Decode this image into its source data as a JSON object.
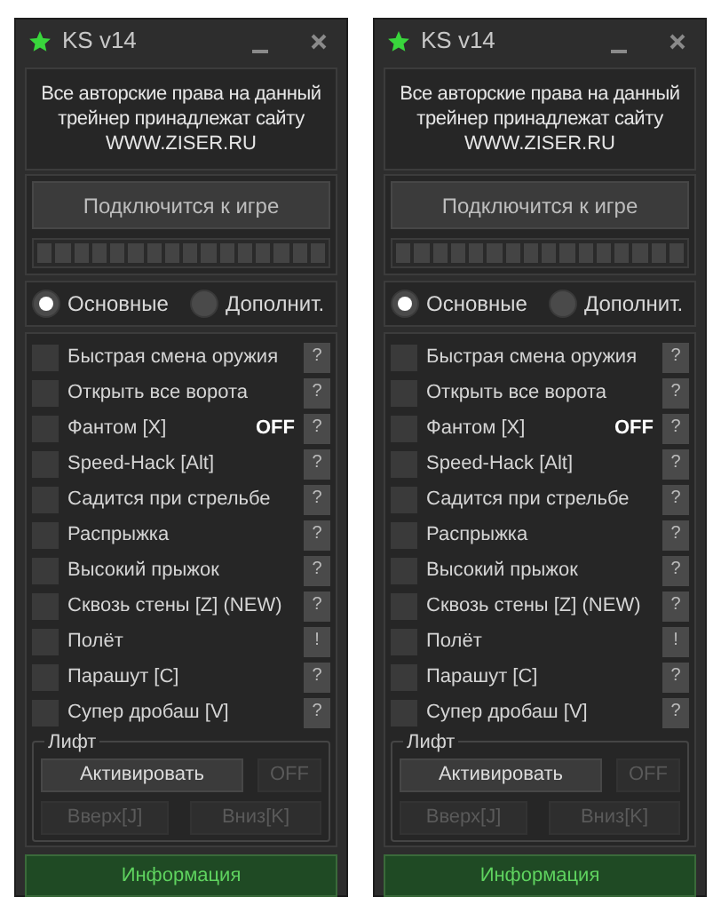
{
  "windows": [
    {
      "title": "KS v14",
      "notice": "Все авторские права на данный трейнер принадлежат сайту",
      "site": "WWW.ZISER.RU",
      "connect_button": "Подключится к игре",
      "progress": {
        "level": 0
      },
      "tabs": [
        {
          "label": "Основные",
          "selected": true
        },
        {
          "label": "Дополнит.",
          "selected": false
        }
      ],
      "options": [
        {
          "label": "Быстрая смена оружия",
          "checked": false,
          "help": "?"
        },
        {
          "label": "Открыть все ворота",
          "checked": false,
          "help": "?"
        },
        {
          "label": "Фантом [X]",
          "checked": false,
          "status": "OFF",
          "help": "?"
        },
        {
          "label": "Speed-Hack [Alt]",
          "checked": false,
          "help": "?"
        },
        {
          "label": "Садится при стрельбе",
          "checked": false,
          "help": "?"
        },
        {
          "label": "Распрыжка",
          "checked": false,
          "help": "?"
        },
        {
          "label": "Высокий прыжок",
          "checked": false,
          "help": "?"
        },
        {
          "label": "Сквозь стены [Z] (NEW)",
          "checked": false,
          "help": "?"
        },
        {
          "label": "Полёт",
          "checked": false,
          "help": "!"
        },
        {
          "label": "Парашут [C]",
          "checked": false,
          "help": "?"
        },
        {
          "label": "Супер дробаш [V]",
          "checked": false,
          "help": "?"
        }
      ],
      "lift": {
        "legend": "Лифт",
        "buttons": [
          {
            "label": "Активировать",
            "disabled": false
          },
          {
            "label": "OFF",
            "disabled": true
          },
          {
            "label": "Вверх[J]",
            "disabled": true
          },
          {
            "label": "Вниз[K]",
            "disabled": true
          }
        ]
      },
      "info_button": "Информация"
    },
    {
      "title": "KS v14",
      "notice": "Все авторские права на данный трейнер принадлежат сайту",
      "site": "WWW.ZISER.RU",
      "connect_button": "Подключится к игре",
      "progress": {
        "level": 0
      },
      "tabs": [
        {
          "label": "Основные",
          "selected": true
        },
        {
          "label": "Дополнит.",
          "selected": false
        }
      ],
      "options": [
        {
          "label": "Быстрая смена оружия",
          "checked": false,
          "help": "?"
        },
        {
          "label": "Открыть все ворота",
          "checked": false,
          "help": "?"
        },
        {
          "label": "Фантом [X]",
          "checked": false,
          "status": "OFF",
          "help": "?"
        },
        {
          "label": "Speed-Hack [Alt]",
          "checked": false,
          "help": "?"
        },
        {
          "label": "Садится при стрельбе",
          "checked": false,
          "help": "?"
        },
        {
          "label": "Распрыжка",
          "checked": false,
          "help": "?"
        },
        {
          "label": "Высокий прыжок",
          "checked": false,
          "help": "?"
        },
        {
          "label": "Сквозь стены [Z] (NEW)",
          "checked": false,
          "help": "?"
        },
        {
          "label": "Полёт",
          "checked": false,
          "help": "!"
        },
        {
          "label": "Парашут [C]",
          "checked": false,
          "help": "?"
        },
        {
          "label": "Супер дробаш [V]",
          "checked": false,
          "help": "?"
        }
      ],
      "lift": {
        "legend": "Лифт",
        "buttons": [
          {
            "label": "Активировать",
            "disabled": false
          },
          {
            "label": "OFF",
            "disabled": true
          },
          {
            "label": "Вверх[J]",
            "disabled": true
          },
          {
            "label": "Вниз[K]",
            "disabled": true
          }
        ]
      },
      "info_button": "Информация"
    }
  ]
}
